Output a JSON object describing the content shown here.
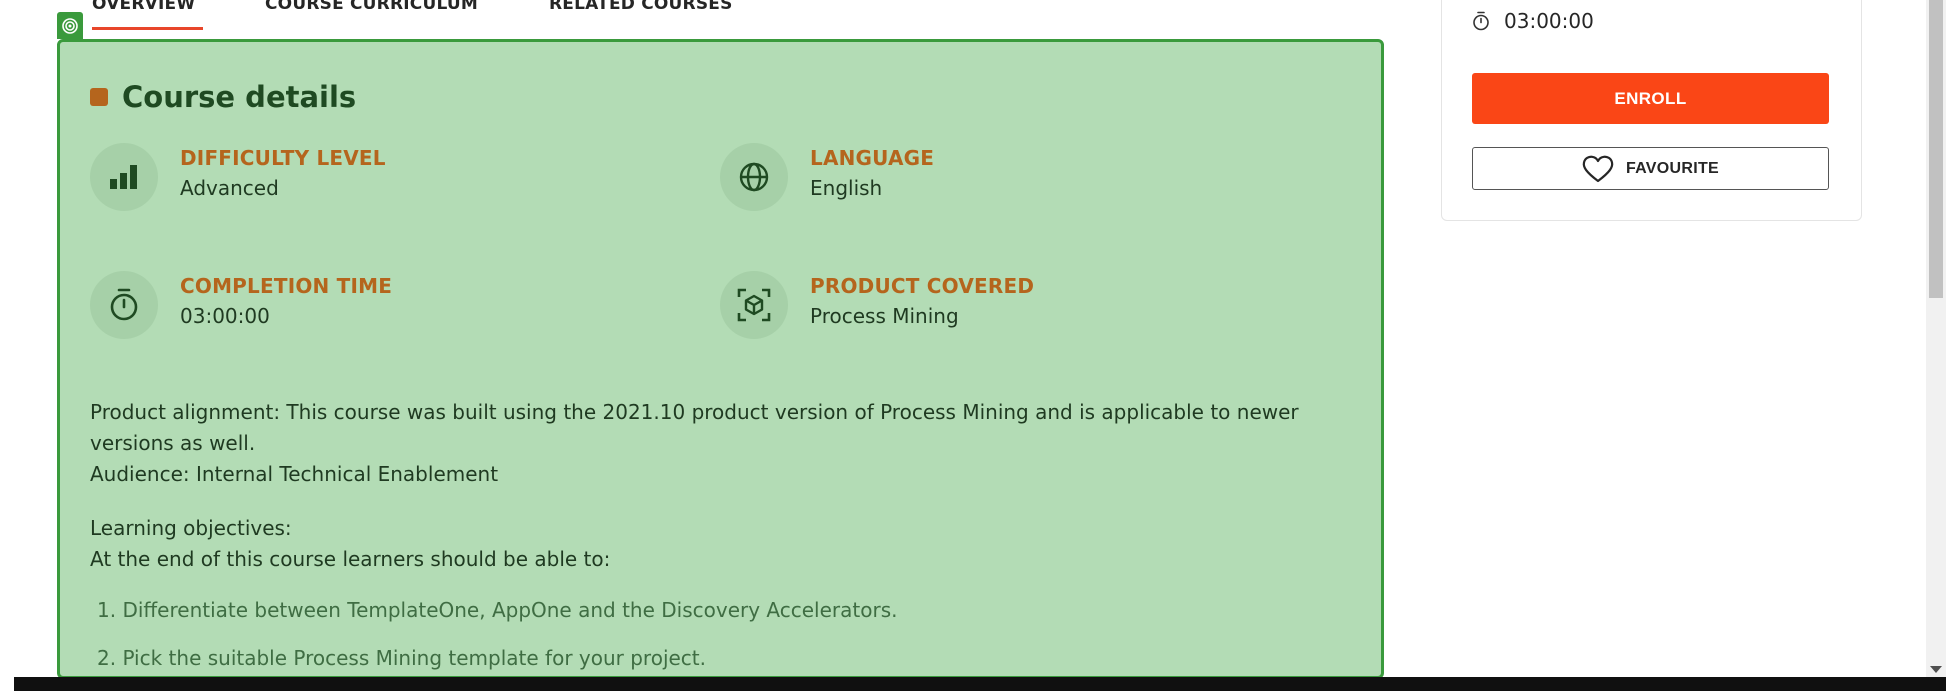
{
  "tabs": [
    {
      "label": "OVERVIEW",
      "active": true
    },
    {
      "label": "COURSE CURRICULUM",
      "active": false
    },
    {
      "label": "RELATED COURSES",
      "active": false
    }
  ],
  "course_details": {
    "title": "Course details",
    "difficulty": {
      "label": "DIFFICULTY LEVEL",
      "value": "Advanced",
      "icon": "bar-chart-icon"
    },
    "language": {
      "label": "LANGUAGE",
      "value": "English",
      "icon": "globe-icon"
    },
    "completion": {
      "label": "COMPLETION TIME",
      "value": "03:00:00",
      "icon": "stopwatch-icon"
    },
    "product": {
      "label": "PRODUCT COVERED",
      "value": "Process Mining",
      "icon": "cube-scan-icon"
    }
  },
  "description": {
    "alignment": "Product alignment: This course was built using the 2021.10 product version of Process Mining and is applicable to newer versions as well.",
    "audience": "Audience: Internal Technical Enablement",
    "objectives_heading": "Learning objectives:",
    "objectives_intro": "At the end of this course learners should be able to:",
    "objectives": [
      "1. Differentiate between TemplateOne, AppOne and the Discovery Accelerators.",
      "2. Pick the suitable Process Mining template for your project."
    ]
  },
  "sidebar": {
    "duration": "03:00:00",
    "enroll_label": "ENROLL",
    "favourite_label": "FAVOURITE"
  },
  "colors": {
    "accent": "#fa4616",
    "highlight_bg": "#b3dcb5",
    "highlight_border": "#3a9a3c",
    "label_color": "#b5651d"
  }
}
